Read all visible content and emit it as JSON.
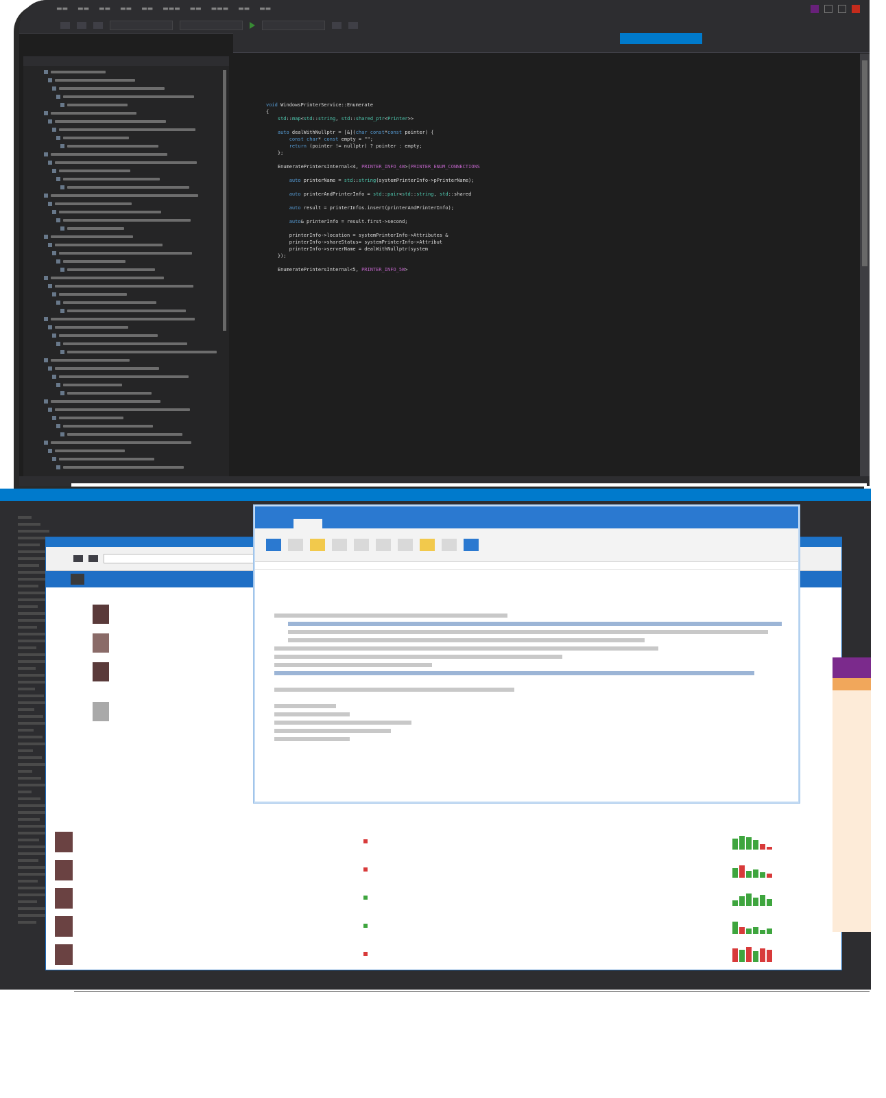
{
  "ide": {
    "tabs": [
      "",
      "",
      "",
      "",
      "",
      "",
      "",
      "",
      "",
      ""
    ],
    "active_tab_index": 6,
    "code_lines": [
      {
        "n": "",
        "t": ""
      },
      {
        "n": "",
        "t": ""
      },
      {
        "n": "",
        "t": ""
      },
      {
        "n": "",
        "t": ""
      },
      {
        "n": "",
        "t": ""
      },
      {
        "n": "",
        "t": ""
      },
      {
        "n": "",
        "t": ""
      },
      {
        "n": "",
        "t": "void WindowsPrinterService::Enumerate"
      },
      {
        "n": "",
        "t": "{"
      },
      {
        "n": "",
        "t": "    std::map<std::string, std::shared_ptr<Printer>>"
      },
      {
        "n": "",
        "t": ""
      },
      {
        "n": "",
        "t": "    auto dealWithNullptr = [&](char const*const pointer) {"
      },
      {
        "n": "",
        "t": "        const char* const empty = \"\";"
      },
      {
        "n": "",
        "t": "        return (pointer != nullptr) ? pointer : empty;"
      },
      {
        "n": "",
        "t": "    };"
      },
      {
        "n": "",
        "t": ""
      },
      {
        "n": "",
        "t": "    EnumeratePrintersInternal<4, PRINTER_INFO_4W>(PRINTER_ENUM_CONNECTIONS"
      },
      {
        "n": "",
        "t": ""
      },
      {
        "n": "",
        "t": "        auto printerName = std::string(systemPrinterInfo->pPrinterName);"
      },
      {
        "n": "",
        "t": ""
      },
      {
        "n": "",
        "t": "        auto printerAndPrinterInfo = std::pair<std::string, std::shared"
      },
      {
        "n": "",
        "t": ""
      },
      {
        "n": "",
        "t": "        auto result = printerInfos.insert(printerAndPrinterInfo);"
      },
      {
        "n": "",
        "t": ""
      },
      {
        "n": "",
        "t": "        auto& printerInfo = result.first->second;"
      },
      {
        "n": "",
        "t": ""
      },
      {
        "n": "",
        "t": "        printerInfo->location = systemPrinterInfo->Attributes &"
      },
      {
        "n": "",
        "t": "        printerInfo->shareStatus= systemPrinterInfo->Attribut"
      },
      {
        "n": "",
        "t": "        printerInfo->serverName = dealWithNullptr(system"
      },
      {
        "n": "",
        "t": "    });"
      },
      {
        "n": "",
        "t": ""
      },
      {
        "n": "",
        "t": "    EnumeratePrintersInternal<5, PRINTER_INFO_5W>"
      }
    ]
  },
  "browser": {
    "vsts_header": [
      "",
      ""
    ],
    "tabs": [
      "",
      "",
      "",
      "",
      ""
    ],
    "people": [
      {
        "name": "",
        "sub": ""
      },
      {
        "name": "",
        "sub": ""
      },
      {
        "name": "",
        "sub": ""
      }
    ],
    "pull_requests": [
      {
        "title": "",
        "status": "",
        "desc": "",
        "time": ""
      },
      {
        "title": "",
        "status": "",
        "desc": "",
        "time": ""
      },
      {
        "title": "",
        "status": "",
        "desc": "",
        "time": ""
      },
      {
        "title": "",
        "status": "",
        "desc": "",
        "time": ""
      },
      {
        "title": "",
        "status": "",
        "desc": "",
        "time": ""
      }
    ]
  },
  "outlook": {
    "title": "",
    "ribbon_tabs": [
      "",
      "",
      "",
      "",
      "",
      "",
      "",
      ""
    ]
  },
  "colors": {
    "accent": "#007acc",
    "vsts_blue": "#1f6fc5",
    "status_red": "#d83a3a",
    "status_green": "#3ea53e",
    "status_yellow": "#f2c94c"
  }
}
